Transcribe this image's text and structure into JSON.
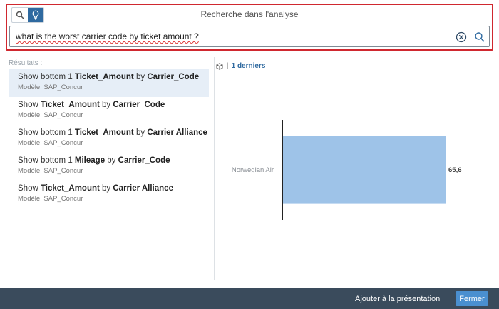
{
  "search_panel": {
    "title": "Recherche dans l'analyse",
    "query": "what is the worst carrier code by ticket amount ?",
    "icons": [
      "search-icon",
      "lightbulb-icon",
      "clear-icon",
      "search-icon"
    ]
  },
  "results": {
    "label": "Résultats :",
    "items": [
      {
        "parts": [
          "Show bottom 1 ",
          "Ticket_Amount",
          " by ",
          "Carrier_Code"
        ],
        "model": "Modèle: SAP_Concur"
      },
      {
        "parts": [
          "Show ",
          "Ticket_Amount",
          " by ",
          "Carrier_Code"
        ],
        "model": "Modèle: SAP_Concur"
      },
      {
        "parts": [
          "Show bottom 1 ",
          "Ticket_Amount",
          " by ",
          "Carrier Alliance"
        ],
        "model": "Modèle: SAP_Concur"
      },
      {
        "parts": [
          "Show bottom 1 ",
          "Mileage",
          " by ",
          "Carrier_Code"
        ],
        "model": "Modèle: SAP_Concur"
      },
      {
        "parts": [
          "Show ",
          "Ticket_Amount",
          " by ",
          "Carrier Alliance"
        ],
        "model": "Modèle: SAP_Concur"
      }
    ]
  },
  "chart_header": {
    "filter_icon": "cube-icon",
    "separator": "|",
    "link": "1 derniers"
  },
  "chart_data": {
    "type": "bar",
    "orientation": "horizontal",
    "categories": [
      "Norwegian Air"
    ],
    "values": [
      65.6
    ],
    "value_labels": [
      "65,6"
    ],
    "xlim": [
      0,
      65.6
    ],
    "grid": false,
    "bar_color": "#9ec3e8"
  },
  "footer": {
    "add_label": "Ajouter à la présentation",
    "close_label": "Fermer"
  },
  "colors": {
    "accent": "#2f6aa0",
    "highlight_border": "#d0282f",
    "footer_bg": "#3a4b5c",
    "primary_button": "#4a8fd0",
    "selected_row": "#e6eef7"
  }
}
